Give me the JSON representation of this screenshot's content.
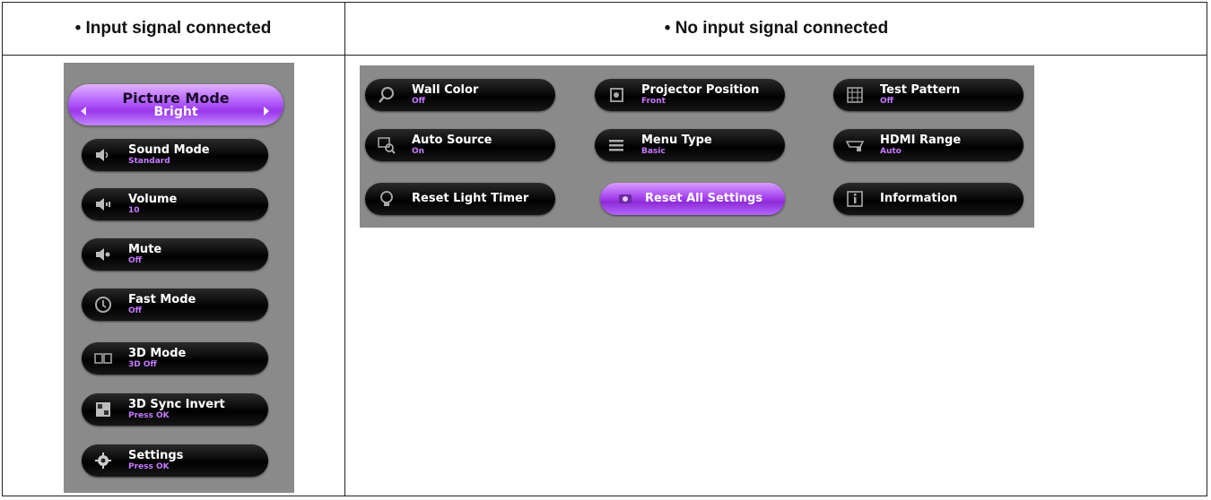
{
  "headers": {
    "left": "• Input signal connected",
    "right": "• No input signal connected"
  },
  "left_menu": {
    "picture_mode": {
      "label": "Picture Mode",
      "value": "Bright"
    },
    "items": [
      {
        "label": "Sound Mode",
        "value": "Standard",
        "icon": "speaker-icon"
      },
      {
        "label": "Volume",
        "value": "10",
        "icon": "volume-icon"
      },
      {
        "label": "Mute",
        "value": "Off",
        "icon": "mute-icon"
      },
      {
        "label": "Fast Mode",
        "value": "Off",
        "icon": "fast-mode-icon"
      },
      {
        "label": "3D Mode",
        "value": "3D Off",
        "icon": "3d-icon"
      },
      {
        "label": "3D Sync Invert",
        "value": "Press OK",
        "icon": "3d-sync-icon"
      },
      {
        "label": "Settings",
        "value": "Press OK",
        "icon": "gear-icon"
      }
    ]
  },
  "right_menu": {
    "items": [
      {
        "label": "Wall Color",
        "value": "Off",
        "icon": "wall-color-icon"
      },
      {
        "label": "Projector Position",
        "value": "Front",
        "icon": "projector-position-icon"
      },
      {
        "label": "Test Pattern",
        "value": "Off",
        "icon": "test-pattern-icon"
      },
      {
        "label": "Auto Source",
        "value": "On",
        "icon": "auto-source-icon"
      },
      {
        "label": "Menu Type",
        "value": "Basic",
        "icon": "menu-type-icon"
      },
      {
        "label": "HDMI Range",
        "value": "Auto",
        "icon": "hdmi-icon"
      },
      {
        "label": "Reset Light Timer",
        "value": "",
        "icon": "light-bulb-icon"
      },
      {
        "label": "Reset All Settings",
        "value": "",
        "icon": "reset-icon"
      },
      {
        "label": "Information",
        "value": "",
        "icon": "info-icon"
      }
    ]
  },
  "colors": {
    "accent": "#a645f0",
    "value_text": "#c77aff",
    "panel_bg": "#8a8a8a"
  }
}
